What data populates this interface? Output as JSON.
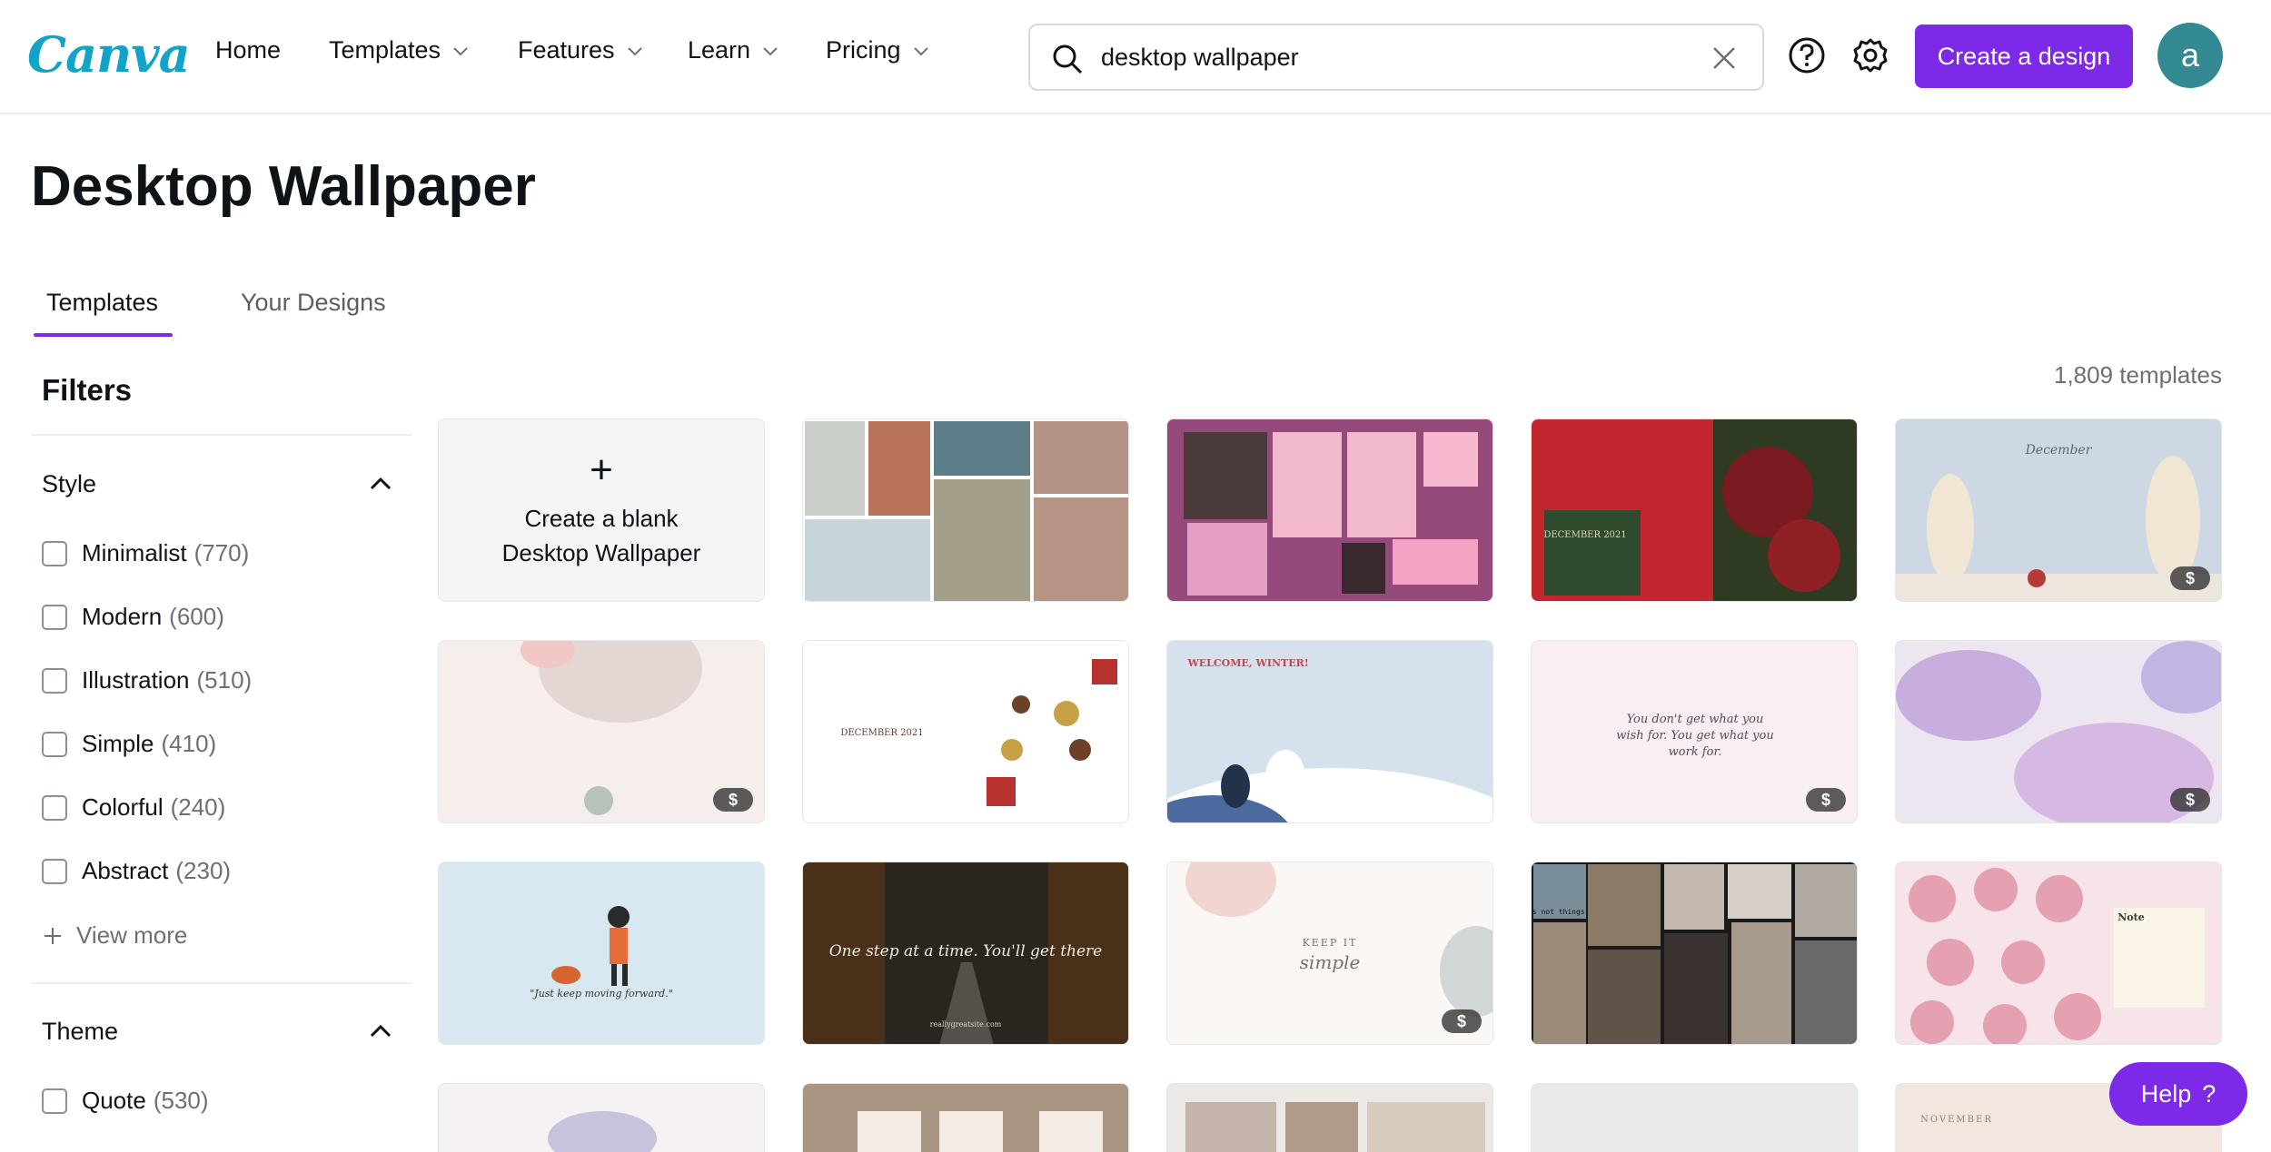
{
  "header": {
    "logo": "Canva",
    "nav": [
      {
        "label": "Home"
      },
      {
        "label": "Templates"
      },
      {
        "label": "Features"
      },
      {
        "label": "Learn"
      },
      {
        "label": "Pricing"
      }
    ],
    "search_value": "desktop wallpaper",
    "create_label": "Create a design",
    "avatar_letter": "a",
    "accent_color": "#7d2ae8"
  },
  "page": {
    "title": "Desktop Wallpaper",
    "tabs": [
      {
        "label": "Templates",
        "active": true
      },
      {
        "label": "Your Designs",
        "active": false
      }
    ],
    "count": "1,809 templates"
  },
  "filters": {
    "title": "Filters",
    "groups": [
      {
        "title": "Style",
        "options": [
          {
            "label": "Minimalist",
            "count": "(770)"
          },
          {
            "label": "Modern",
            "count": "(600)"
          },
          {
            "label": "Illustration",
            "count": "(510)"
          },
          {
            "label": "Simple",
            "count": "(410)"
          },
          {
            "label": "Colorful",
            "count": "(240)"
          },
          {
            "label": "Abstract",
            "count": "(230)"
          }
        ],
        "view_more": "View more"
      },
      {
        "title": "Theme",
        "options": [
          {
            "label": "Quote",
            "count": "(530)"
          }
        ]
      }
    ]
  },
  "grid": {
    "blank_label": "Create a blank Desktop Wallpaper",
    "pro_badge": "$",
    "texts": {
      "t4": "DECEMBER 2021",
      "t5": "December",
      "t7": "DECEMBER 2021",
      "t8": "WELCOME, WINTER!",
      "t9": "You don't get what you wish for. You get what you work for.",
      "t11": "\"Just keep moving forward.\"",
      "t12": "One step at a time. You'll get there",
      "t12b": "reallygreatsite.com",
      "t13a": "KEEP IT",
      "t13b": "simple",
      "t14": "Collect moments not things",
      "t15": "Note",
      "t20": "NOVEMBER"
    }
  },
  "help_label": "Help"
}
